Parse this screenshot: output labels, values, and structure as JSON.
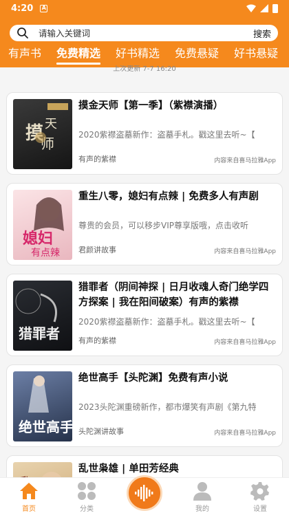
{
  "status": {
    "time": "4:20",
    "notif_letter": "A"
  },
  "search": {
    "placeholder": "请输入关键词",
    "button": "搜索"
  },
  "tabs": [
    "有声书",
    "免费精选",
    "好书精选",
    "免费悬疑",
    "好书悬疑"
  ],
  "active_tab": 1,
  "pull_text": "上次更新 7-7 16:20",
  "books": [
    {
      "title": "摸金天师【第一季】（紫襟演播）",
      "desc": "2020紫襟盗墓新作：盗墓手札。戳这里去听~【",
      "author": "有声的紫襟",
      "source": "内容来自喜马拉雅App",
      "cover_color": "#2a2a2a",
      "cover_text": "摸天金师"
    },
    {
      "title": "重生八零，媳妇有点辣 | 免费多人有声剧",
      "desc": "尊贵的会员，可以移步VIP尊享版哦，点击收听",
      "author": "君颜讲故事",
      "source": "内容来自喜马拉雅App",
      "cover_color": "#f3d3d6",
      "cover_text": "媳妇有点辣"
    },
    {
      "title": "猎罪者（阴间神探 | 日月收魂人奇门绝学四方探案 | 我在阳间破案）有声的紫襟",
      "desc": "2020紫襟盗墓新作：盗墓手札。戳这里去听~【",
      "author": "有声的紫襟",
      "source": "内容来自喜马拉雅App",
      "cover_color": "#1d1f24",
      "cover_text": "猎罪者"
    },
    {
      "title": "绝世高手【头陀渊】免费有声小说",
      "desc": "2023头陀渊重磅新作，都市爆笑有声剧《第九特",
      "author": "头陀渊讲故事",
      "source": "内容来自喜马拉雅App",
      "cover_color": "#3b4a6a",
      "cover_text": "绝世高手"
    },
    {
      "title": "乱世枭雄 | 单田芳经典",
      "desc": "",
      "author": "",
      "source": "",
      "cover_color": "#d9b98a",
      "cover_text": "乱"
    }
  ],
  "nav": [
    {
      "label": "首页",
      "icon": "home-icon",
      "active": true
    },
    {
      "label": "分类",
      "icon": "category-icon",
      "active": false
    },
    {
      "label": "",
      "icon": "audio-wave-icon",
      "active": false
    },
    {
      "label": "我的",
      "icon": "user-icon",
      "active": false
    },
    {
      "label": "设置",
      "icon": "gear-icon",
      "active": false
    }
  ],
  "colors": {
    "accent": "#f5891d",
    "active_nav": "#f5891d"
  }
}
